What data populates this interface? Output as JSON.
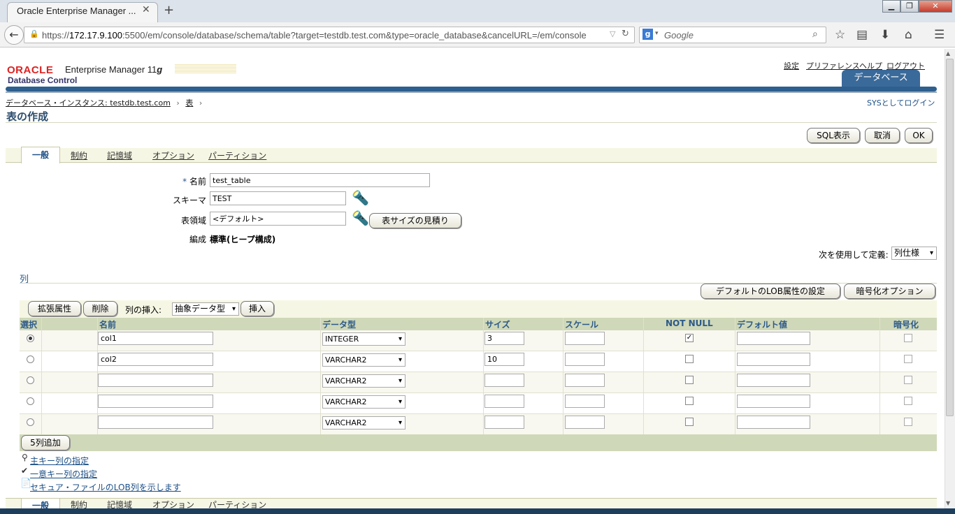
{
  "browser": {
    "tab_title": "Oracle Enterprise Manager ...",
    "url_prefix": "https://",
    "url_host": "172.17.9.100",
    "url_rest": ":5500/em/console/database/schema/table?target=testdb.test.com&type=oracle_database&cancelURL=/em/console",
    "search_placeholder": "Google"
  },
  "header": {
    "logo_oracle": "ORACLE",
    "logo_em": "Enterprise Manager 11",
    "logo_em_g": "g",
    "logo_dc": "Database Control",
    "global_links": [
      "設定",
      "プリファレンス",
      "ヘルプ",
      "ログアウト"
    ],
    "db_tab": "データベース"
  },
  "breadcrumb": {
    "instance": "データベース・インスタンス: testdb.test.com",
    "table": "表",
    "sys_login": "SYSとしてログイン"
  },
  "page_title": "表の作成",
  "top_buttons": {
    "sql": "SQL表示",
    "cancel": "取消",
    "ok": "OK"
  },
  "tabs": [
    "一般",
    "制約",
    "記憶域",
    "オプション",
    "パーティション"
  ],
  "form": {
    "name_label": "名前",
    "name_value": "test_table",
    "schema_label": "スキーマ",
    "schema_value": "TEST",
    "tablespace_label": "表領域",
    "tablespace_value": "<デフォルト>",
    "estimate_button": "表サイズの見積り",
    "org_label": "編成",
    "org_value": "標準(ヒープ構成)",
    "define_label": "次を使用して定義:",
    "define_value": "列仕様"
  },
  "columns_section": {
    "title": "列",
    "default_lob_button": "デフォルトのLOB属性の設定",
    "encrypt_button": "暗号化オプション",
    "ext_attr_button": "拡張属性",
    "delete_button": "削除",
    "insert_label": "列の挿入:",
    "insert_type": "抽象データ型",
    "insert_button": "挿入",
    "headers": [
      "選択",
      "名前",
      "データ型",
      "サイズ",
      "スケール",
      "NOT NULL",
      "デフォルト値",
      "暗号化"
    ],
    "rows": [
      {
        "selected": true,
        "name": "col1",
        "type": "INTEGER",
        "size": "3",
        "scale": "",
        "not_null": true,
        "default": "",
        "encrypt": false
      },
      {
        "selected": false,
        "name": "col2",
        "type": "VARCHAR2",
        "size": "10",
        "scale": "",
        "not_null": false,
        "default": "",
        "encrypt": false
      },
      {
        "selected": false,
        "name": "",
        "type": "VARCHAR2",
        "size": "",
        "scale": "",
        "not_null": false,
        "default": "",
        "encrypt": false
      },
      {
        "selected": false,
        "name": "",
        "type": "VARCHAR2",
        "size": "",
        "scale": "",
        "not_null": false,
        "default": "",
        "encrypt": false
      },
      {
        "selected": false,
        "name": "",
        "type": "VARCHAR2",
        "size": "",
        "scale": "",
        "not_null": false,
        "default": "",
        "encrypt": false
      }
    ],
    "add_button": "5列追加"
  },
  "legend": [
    "主キー列の指定",
    "一意キー列の指定",
    "セキュア・ファイルのLOB列を示します"
  ]
}
